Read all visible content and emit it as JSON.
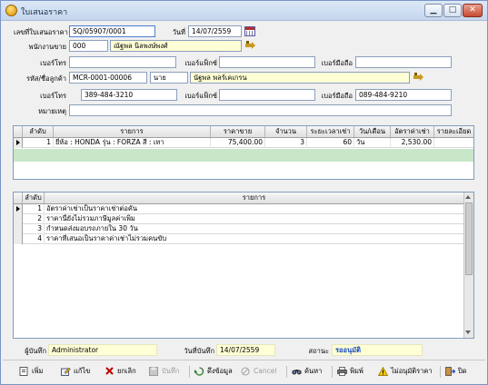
{
  "window": {
    "title": "ใบเสนอราคา"
  },
  "colors": {
    "accent": "#1a4cc0",
    "selected_row": "#c8e6c8",
    "field_highlight": "#ffffd6"
  },
  "form": {
    "quote_no_label": "เลขที่ใบเสนอราคา",
    "quote_no": "SQ/05907/0001",
    "date_label": "วันที่",
    "date": "14/07/2559",
    "employee_label": "พนักงานขาย",
    "employee_code": "000",
    "employee_name": "ณัฐพล นิลพงษ์พงศ์",
    "phone_label": "เบอร์โทร",
    "fax_label": "เบอร์แฟ็กซ์",
    "mobile_label": "เบอร์มือถือ",
    "employee_phone": "",
    "employee_fax": "",
    "employee_mobile": "",
    "customer_label": "รหัส/ชื่อลูกค้า",
    "customer_code": "MCR-0001-00006",
    "customer_title": "นาย",
    "customer_name": "นัฐพล พลร์เคเกรน",
    "customer_phone": "389-484-3210",
    "customer_fax": "",
    "customer_mobile": "089-484-9210",
    "note_label": "หมายเหตุ",
    "note": ""
  },
  "items_table": {
    "columns": [
      "ลำดับ",
      "รายการ",
      "ราคาขาย",
      "จำนวน",
      "ระยะเวลาเช่า",
      "วัน/เดือน",
      "อัตราค่าเช่า",
      "รายละเอียด"
    ],
    "rows": [
      {
        "no": "1",
        "item": "ยี่ห้อ : HONDA รุ่น : FORZA สี : เทา",
        "price": "75,400.00",
        "qty": "3",
        "period": "60",
        "unit": "วัน",
        "rate": "2,530.00",
        "detail": ""
      }
    ]
  },
  "conditions_table": {
    "columns": [
      "ลำดับ",
      "รายการ"
    ],
    "rows": [
      {
        "no": "1",
        "text": "อัตราค่าเช่าเป็นราคาเช่าต่อคัน"
      },
      {
        "no": "2",
        "text": "ราคานี้ยังไม่รวมภาษีมูลค่าเพิ่ม"
      },
      {
        "no": "3",
        "text": "กำหนดส่งมอบรถภายใน 30 วัน"
      },
      {
        "no": "4",
        "text": "ราคาที่เสนอเป็นราคาค่าเช่าไม่รวมคนขับ"
      }
    ]
  },
  "footer": {
    "recorder_label": "ผู้บันทึก",
    "recorder": "Administrator",
    "record_date_label": "วันที่บันทึก",
    "record_date": "14/07/2559",
    "status_label": "สถานะ",
    "status": "รออนุมัติ"
  },
  "toolbar": {
    "add": "เพิ่ม",
    "edit": "แก้ไข",
    "cancel_doc": "ยกเลิก",
    "save": "บันทึก",
    "restore": "ดึงข้อมูล",
    "cancel": "Cancel",
    "search": "ค้นหา",
    "print": "พิมพ์",
    "reject": "ไม่อนุมัติราคา",
    "close": "ปิด"
  }
}
